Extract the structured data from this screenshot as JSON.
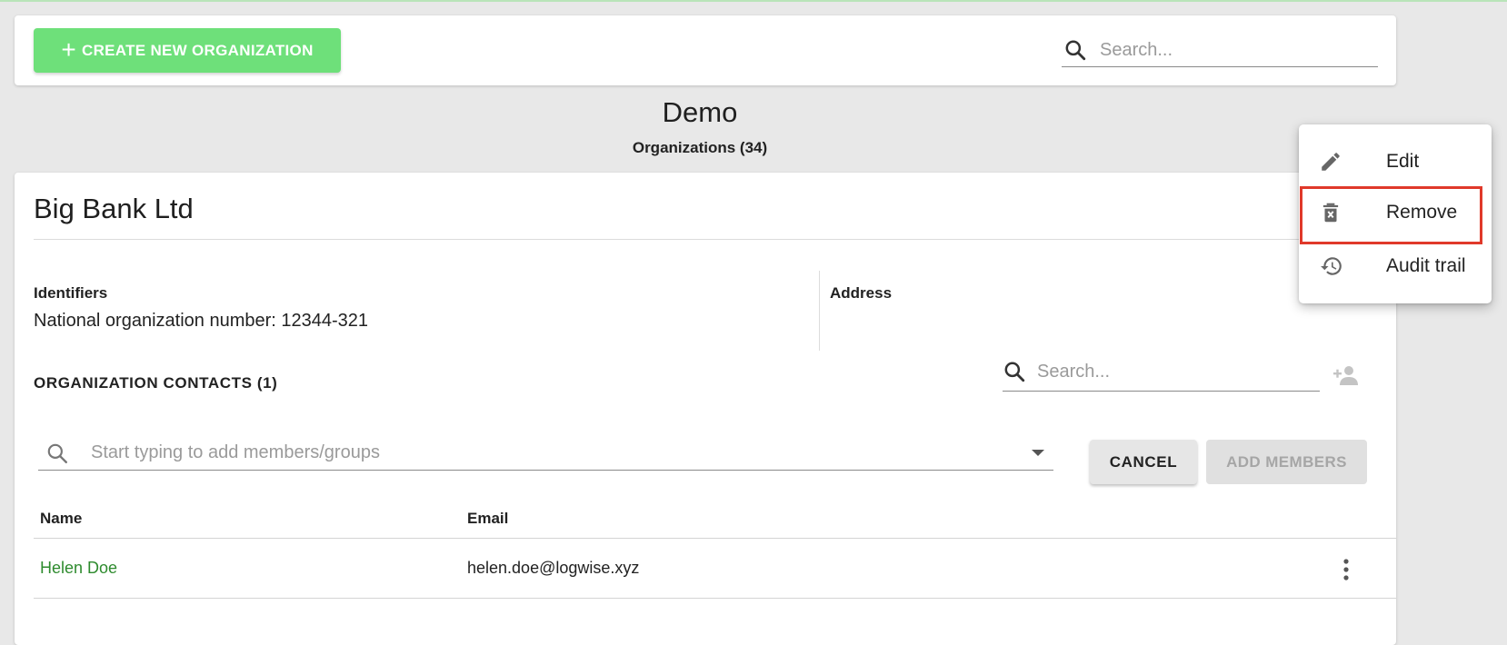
{
  "toolbar": {
    "create_label": "CREATE NEW ORGANIZATION",
    "search_placeholder": "Search..."
  },
  "header": {
    "title": "Demo",
    "subtitle": "Organizations (34)"
  },
  "organization": {
    "name": "Big Bank Ltd",
    "identifiers_label": "Identifiers",
    "identifier_value": "National organization number: 12344-321",
    "address_label": "Address",
    "contacts_label": "ORGANIZATION CONTACTS (1)",
    "contacts_search_placeholder": "Search...",
    "member_input_placeholder": "Start typing to add members/groups",
    "cancel_label": "CANCEL",
    "add_members_label": "ADD MEMBERS",
    "table": {
      "columns": [
        "Name",
        "Email"
      ],
      "rows": [
        {
          "name": "Helen Doe",
          "email": "helen.doe@logwise.xyz"
        }
      ]
    }
  },
  "context_menu": {
    "items": [
      {
        "label": "Edit",
        "icon": "pencil-icon"
      },
      {
        "label": "Remove",
        "icon": "trash-icon",
        "highlighted": true
      },
      {
        "label": "Audit trail",
        "icon": "history-icon"
      }
    ]
  },
  "colors": {
    "primary_green": "#6ee07a",
    "link_green": "#2e8b2e",
    "highlight_red": "#e0392a",
    "background": "#e8e8e8"
  }
}
